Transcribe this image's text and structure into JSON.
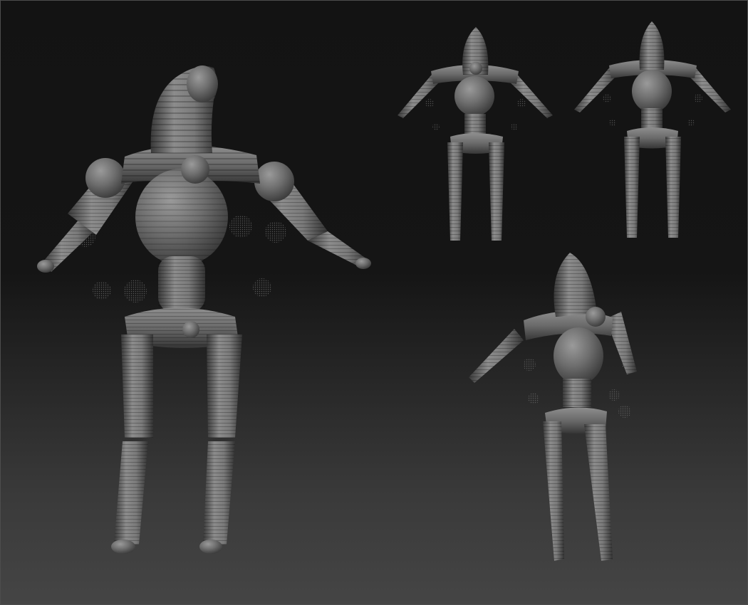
{
  "scene": {
    "type": "3d-sculpt-viewport",
    "subject": "mannequin-figure-zsphere-rig",
    "views": [
      {
        "name": "perspective-front-large"
      },
      {
        "name": "front-orthographic"
      },
      {
        "name": "back-orthographic"
      },
      {
        "name": "three-quarter-perspective"
      }
    ]
  },
  "colors": {
    "background_top": "#131313",
    "background_bottom": "#454545",
    "material_light": "#8a8a8a",
    "material_mid": "#6a6a6a",
    "material_dark": "#3a3a3a",
    "stripe_dark": "#555555"
  }
}
